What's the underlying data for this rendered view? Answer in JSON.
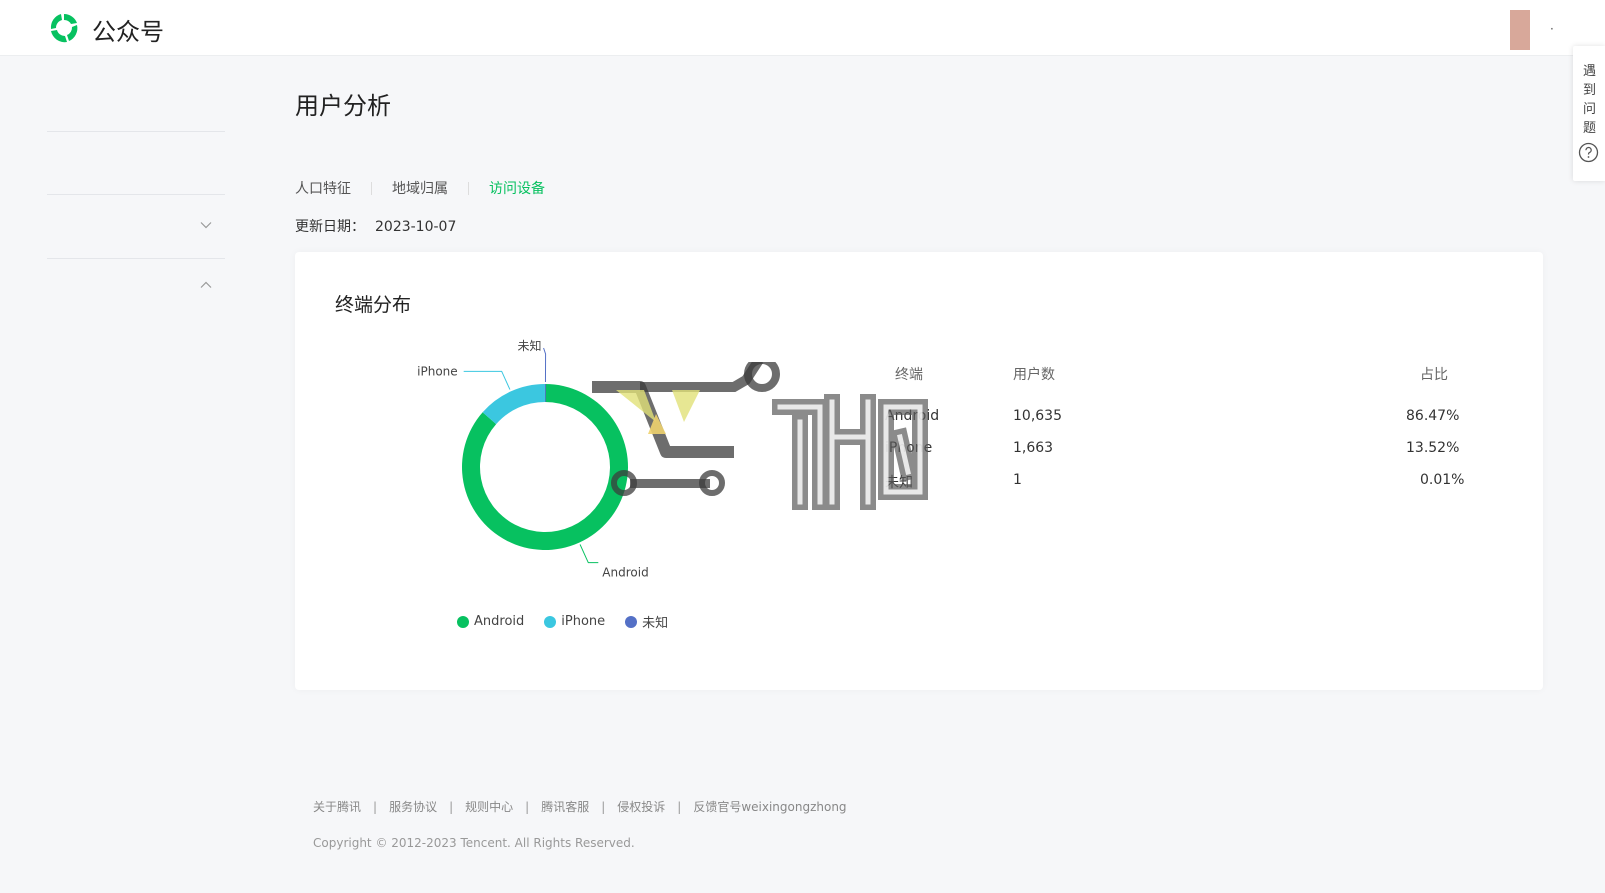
{
  "header": {
    "title": "公众号",
    "dot": "·"
  },
  "help": {
    "label": "遇到问题"
  },
  "page": {
    "title": "用户分析",
    "tabs": [
      {
        "label": "人口特征"
      },
      {
        "label": "地域归属"
      },
      {
        "label": "访问设备"
      }
    ],
    "active_tab": "访问设备",
    "update_label": "更新日期：",
    "update_date": "2023-10-07"
  },
  "card": {
    "title": "终端分布",
    "table": {
      "headers": [
        "终端",
        "用户数",
        "占比"
      ],
      "rows": [
        {
          "terminal": "Android",
          "users": "10,635",
          "share": "86.47%"
        },
        {
          "terminal": "iPhone",
          "users": "1,663",
          "share": "13.52%"
        },
        {
          "terminal": "未知",
          "users": "1",
          "share": "0.01%"
        }
      ]
    }
  },
  "chart_data": {
    "type": "pie",
    "donut": true,
    "categories": [
      "Android",
      "iPhone",
      "未知"
    ],
    "values": [
      10635,
      1663,
      1
    ],
    "percentages": [
      86.47,
      13.52,
      0.01
    ],
    "colors": [
      "#07c160",
      "#3bc7e0",
      "#5470c6"
    ],
    "legend_position": "bottom-left"
  },
  "footer": {
    "links": [
      "关于腾讯",
      "服务协议",
      "规则中心",
      "腾讯客服",
      "侵权投诉",
      "反馈官号weixingongzhong"
    ],
    "copyright": "Copyright © 2012-2023 Tencent. All Rights Reserved."
  }
}
